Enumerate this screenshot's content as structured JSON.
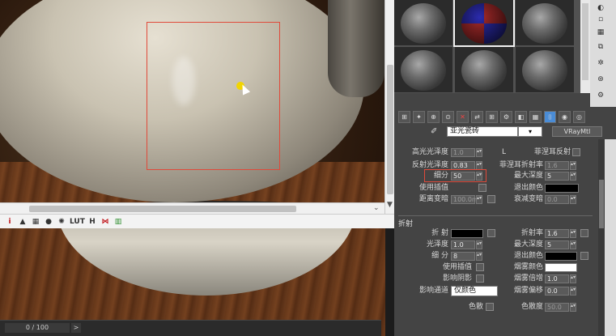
{
  "timeline": {
    "frame_label": "0 / 100",
    "next_label": ">"
  },
  "frame_toolbar": {
    "items": [
      "i",
      "▲",
      "▦",
      "●",
      "✺",
      "LUT",
      "H",
      "⋈",
      "▥"
    ]
  },
  "mat_toolbar": {
    "items": [
      "⊞",
      "✦",
      "⊕",
      "⊙",
      "✕",
      "⇄",
      "⊞",
      "⚙",
      "◧",
      "▦",
      "⌷",
      "◉",
      "◎"
    ]
  },
  "material": {
    "name": "亚光瓷砖",
    "type": "VRayMtl",
    "dd_arrow": "▾"
  },
  "reflection": {
    "hilight_gloss_label": "高光光泽度",
    "hilight_gloss_value": "1.0",
    "lock_label": "L",
    "fresnel_label": "菲涅耳反射",
    "refl_gloss_label": "反射光泽度",
    "refl_gloss_value": "0.83",
    "fresnel_ior_label": "菲涅耳折射率",
    "fresnel_ior_value": "1.6",
    "subdivs_label": "细分",
    "subdivs_value": "50",
    "max_depth_label": "最大深度",
    "max_depth_value": "5",
    "use_interp_label": "使用插值",
    "exit_color_label": "退出颜色",
    "dim_dist_label": "距离变暗",
    "dim_dist_value": "100.0m",
    "dim_falloff_label": "衰减变暗",
    "dim_falloff_value": "0.0"
  },
  "refraction": {
    "section_label": "折射",
    "refract_label": "折 射",
    "ior_label": "折射率",
    "ior_value": "1.6",
    "gloss_label": "光泽度",
    "gloss_value": "1.0",
    "max_depth_label": "最大深度",
    "max_depth_value": "5",
    "subdivs_label": "细 分",
    "subdivs_value": "8",
    "exit_color_label": "退出颜色",
    "use_interp_label": "使用插值",
    "fog_color_label": "烟雾颜色",
    "affect_shadows_label": "影响阴影",
    "fog_mult_label": "烟雾倍增",
    "fog_mult_value": "1.0",
    "affect_channels_label": "影响通道",
    "affect_channels_value": "仅颜色",
    "fog_bias_label": "烟雾偏移",
    "fog_bias_value": "0.0",
    "dispersion_label": "色散",
    "abbe_label": "色散度",
    "abbe_value": "50.0"
  },
  "colors": {
    "selection": "#e04a3a",
    "cursor_dot": "#f2d500",
    "active_btn": "#4a8cd6"
  }
}
